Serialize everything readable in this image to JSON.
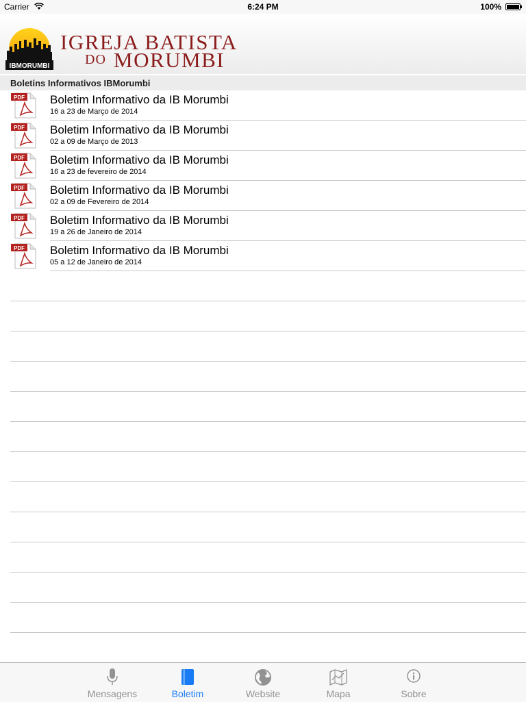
{
  "status_bar": {
    "carrier": "Carrier",
    "time": "6:24 PM",
    "battery": "100%"
  },
  "header": {
    "logo_line1": "IGREJA BATISTA",
    "logo_do": "DO",
    "logo_line2": "MORUMBI",
    "logo_badge": "IBMORUMBI",
    "brand_color": "#8c1c1c"
  },
  "section": {
    "title": "Boletins Informativos IBMorumbi"
  },
  "bulletins": [
    {
      "title": "Boletim Informativo da IB Morumbi",
      "date": "16 a 23 de Março de 2014",
      "icon": "pdf-icon"
    },
    {
      "title": "Boletim Informativo da IB Morumbi",
      "date": "02 a 09 de Março de 2013",
      "icon": "pdf-icon"
    },
    {
      "title": "Boletim Informativo da IB Morumbi",
      "date": "16 a 23 de fevereiro de 2014",
      "icon": "pdf-icon"
    },
    {
      "title": "Boletim Informativo da IB Morumbi",
      "date": "02 a 09 de Fevereiro de 2014",
      "icon": "pdf-icon"
    },
    {
      "title": "Boletim Informativo da IB Morumbi",
      "date": "19 a 26 de Janeiro de 2014",
      "icon": "pdf-icon"
    },
    {
      "title": "Boletim Informativo da IB Morumbi",
      "date": "05 a 12 de Janeiro de 2014",
      "icon": "pdf-icon"
    }
  ],
  "tabs": [
    {
      "label": "Mensagens",
      "icon": "microphone-icon",
      "active": false
    },
    {
      "label": "Boletim",
      "icon": "book-icon",
      "active": true
    },
    {
      "label": "Website",
      "icon": "globe-icon",
      "active": false
    },
    {
      "label": "Mapa",
      "icon": "map-icon",
      "active": false
    },
    {
      "label": "Sobre",
      "icon": "info-icon",
      "active": false
    }
  ],
  "colors": {
    "active_tab": "#1a7cf5",
    "inactive_tab": "#929292",
    "pdf_red": "#b3221e"
  }
}
